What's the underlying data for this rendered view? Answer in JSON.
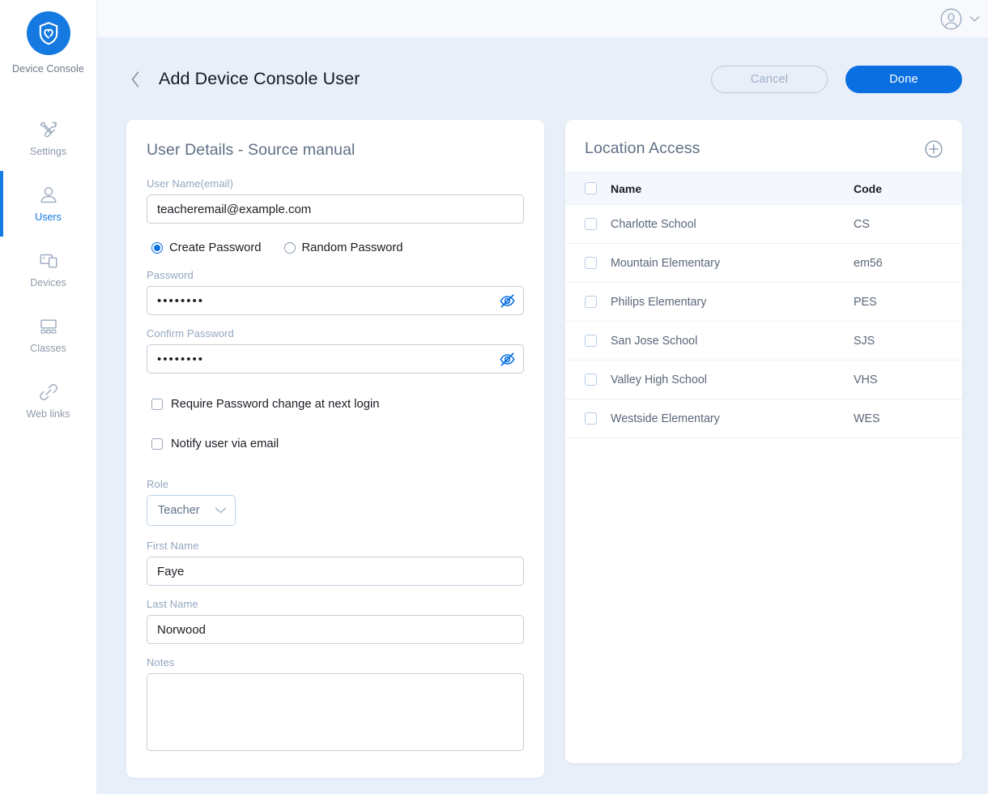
{
  "brand": {
    "label": "Device Console",
    "logo_icon": "shield-heart-icon",
    "logo_color": "#1479e0"
  },
  "sidebar": {
    "items": [
      {
        "label": "Settings",
        "icon": "tools-icon",
        "active": false
      },
      {
        "label": "Users",
        "icon": "user-icon",
        "active": true
      },
      {
        "label": "Devices",
        "icon": "devices-icon",
        "active": false
      },
      {
        "label": "Classes",
        "icon": "classroom-icon",
        "active": false
      },
      {
        "label": "Web links",
        "icon": "link-icon",
        "active": false
      }
    ],
    "active_color": "#1479e0",
    "inactive_color": "#8f9aab"
  },
  "topbar": {
    "avatar_icon": "user-avatar-icon",
    "chevron_icon": "chevron-down-icon"
  },
  "page": {
    "back_icon": "chevron-left-icon",
    "title": "Add Device Console User",
    "cancel_label": "Cancel",
    "done_label": "Done",
    "done_color": "#0a6fe0"
  },
  "user_details": {
    "section_title": "User Details  -  Source manual",
    "username": {
      "label": "User Name(email)",
      "value": "teacheremail@example.com",
      "placeholder": "User Name(email)"
    },
    "password_mode": {
      "options": [
        {
          "label": "Create Password",
          "selected": true
        },
        {
          "label": "Random Password",
          "selected": false
        }
      ]
    },
    "password": {
      "label": "Password",
      "value": "••••••••",
      "masked_chars": 8,
      "toggle_icon": "eye-off-icon",
      "toggle_color": "#0a6fe0"
    },
    "confirm_password": {
      "label": "Confirm Password",
      "value": "••••••••",
      "masked_chars": 8,
      "toggle_icon": "eye-off-icon",
      "toggle_color": "#0a6fe0"
    },
    "checkboxes": [
      {
        "label": "Require Password change at next login",
        "checked": false
      },
      {
        "label": "Notify user via email",
        "checked": false
      }
    ],
    "role": {
      "label": "Role",
      "value": "Teacher",
      "chevron_icon": "chevron-down-icon"
    },
    "first_name": {
      "label": "First Name",
      "value": "Faye",
      "placeholder": "First Name"
    },
    "last_name": {
      "label": "Last Name",
      "value": "Norwood",
      "placeholder": "Last Name"
    },
    "notes": {
      "label": "Notes",
      "value": "",
      "placeholder": ""
    }
  },
  "location_access": {
    "section_title": "Location Access",
    "add_icon": "plus-circle-icon",
    "columns": [
      "Name",
      "Code"
    ],
    "header_checkbox_checked": false,
    "rows": [
      {
        "name": "Charlotte School",
        "code": "CS",
        "checked": false
      },
      {
        "name": "Mountain Elementary",
        "code": "em56",
        "checked": false
      },
      {
        "name": "Philips Elementary",
        "code": "PES",
        "checked": false
      },
      {
        "name": "San Jose School",
        "code": "SJS",
        "checked": false
      },
      {
        "name": "Valley High School",
        "code": "VHS",
        "checked": false
      },
      {
        "name": "Westside Elementary",
        "code": "WES",
        "checked": false
      }
    ]
  },
  "theme": {
    "content_background": "#e9eff9",
    "topbar_background": "#f7f9fc",
    "card_background": "#ffffff",
    "accent": "#0a6fe0",
    "label_color": "#93a7c0"
  }
}
